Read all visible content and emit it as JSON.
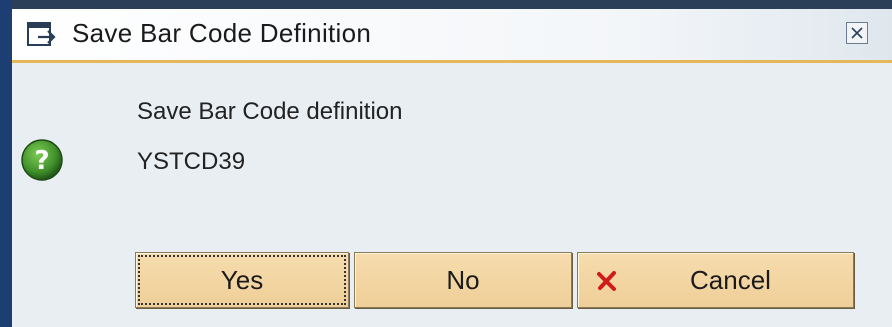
{
  "window": {
    "title": "Save Bar Code Definition",
    "title_icon": "dialog-window-icon",
    "close_icon": "close-icon"
  },
  "message": {
    "icon": "question-icon",
    "line1": "Save Bar Code definition",
    "line2": "YSTCD39"
  },
  "buttons": {
    "yes_label": "Yes",
    "no_label": "No",
    "cancel_label": "Cancel",
    "cancel_icon": "red-x-icon"
  },
  "colors": {
    "frame_blue": "#1d3e72",
    "accent_gold": "#e5b75a",
    "button_fill": "#efcf98",
    "question_green": "#3f8f2a",
    "cancel_red": "#d11a1a"
  }
}
